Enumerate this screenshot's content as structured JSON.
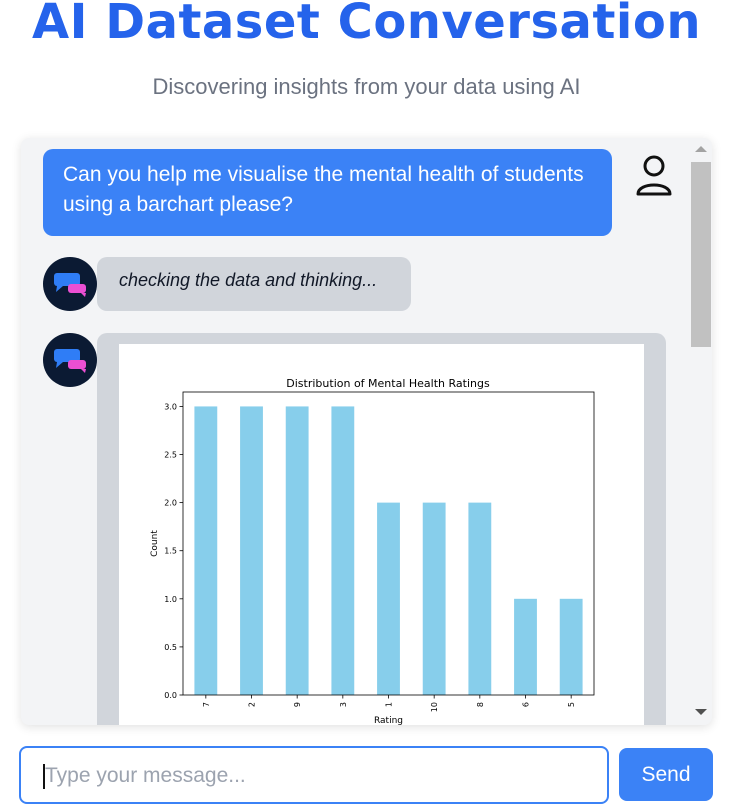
{
  "header": {
    "title": "AI Dataset Conversation",
    "subtitle": "Discovering insights from your data using AI"
  },
  "messages": {
    "user_message": "Can you help me visualise the mental health of students using a barchart please?",
    "ai_thinking": "checking the data and thinking..."
  },
  "input": {
    "placeholder": "Type your message...",
    "value": ""
  },
  "send_label": "Send",
  "colors": {
    "accent": "#3b82f6",
    "title": "#2563eb",
    "bar": "#87ceeb",
    "ai_avatar_bg": "#0b1a33"
  },
  "icons": {
    "user_avatar": "user-outline-icon",
    "ai_avatar": "chat-bubbles-icon"
  },
  "chart_data": {
    "type": "bar",
    "title": "Distribution of Mental Health Ratings",
    "xlabel": "Rating",
    "ylabel": "Count",
    "categories": [
      "7",
      "2",
      "9",
      "3",
      "1",
      "10",
      "8",
      "6",
      "5"
    ],
    "values": [
      3,
      3,
      3,
      3,
      2,
      2,
      2,
      1,
      1
    ],
    "yticks": [
      "0.0",
      "0.5",
      "1.0",
      "1.5",
      "2.0",
      "2.5",
      "3.0"
    ],
    "ylim": [
      0,
      3.15
    ],
    "grid": false,
    "legend": "none"
  }
}
